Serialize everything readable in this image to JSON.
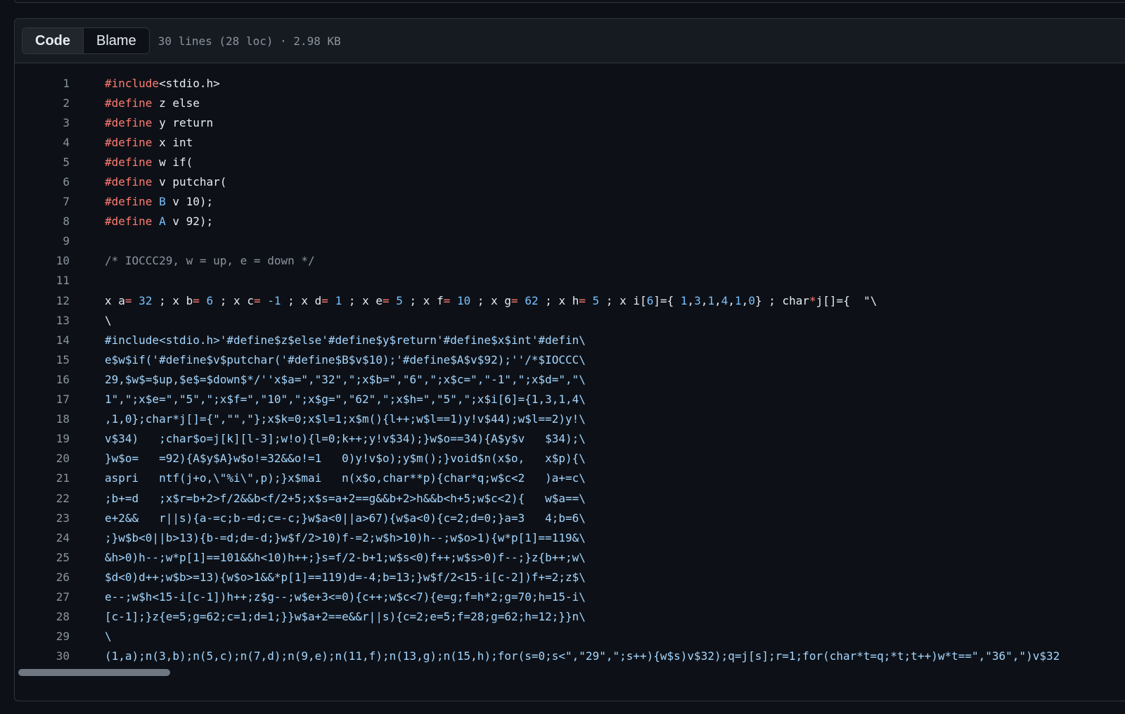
{
  "tabs": {
    "code": "Code",
    "blame": "Blame"
  },
  "file_info": "30 lines (28 loc) · 2.98 KB",
  "lines": [
    {
      "n": "1",
      "t": [
        [
          "kw",
          "#include"
        ],
        [
          "",
          "<stdio.h>"
        ]
      ]
    },
    {
      "n": "2",
      "t": [
        [
          "kw",
          "#define"
        ],
        [
          "",
          " z else"
        ]
      ]
    },
    {
      "n": "3",
      "t": [
        [
          "kw",
          "#define"
        ],
        [
          "",
          " y return"
        ]
      ]
    },
    {
      "n": "4",
      "t": [
        [
          "kw",
          "#define"
        ],
        [
          "",
          " x int"
        ]
      ]
    },
    {
      "n": "5",
      "t": [
        [
          "kw",
          "#define"
        ],
        [
          "",
          " w if("
        ]
      ]
    },
    {
      "n": "6",
      "t": [
        [
          "kw",
          "#define"
        ],
        [
          "",
          " v putchar("
        ]
      ]
    },
    {
      "n": "7",
      "t": [
        [
          "kw",
          "#define"
        ],
        [
          "",
          " "
        ],
        [
          "const",
          "B"
        ],
        [
          "",
          " v 10);"
        ]
      ]
    },
    {
      "n": "8",
      "t": [
        [
          "kw",
          "#define"
        ],
        [
          "",
          " "
        ],
        [
          "const",
          "A"
        ],
        [
          "",
          " v 92);"
        ]
      ]
    },
    {
      "n": "9",
      "t": [
        [
          "",
          ""
        ]
      ]
    },
    {
      "n": "10",
      "t": [
        [
          "comment",
          "/* IOCCC29, w = up, e = down */"
        ]
      ]
    },
    {
      "n": "11",
      "t": [
        [
          "",
          ""
        ]
      ]
    },
    {
      "n": "12",
      "t": [
        [
          "",
          "x a"
        ],
        [
          "kw",
          "="
        ],
        [
          "const",
          " 32"
        ],
        [
          "",
          " ; x b"
        ],
        [
          "kw",
          "="
        ],
        [
          "const",
          " 6"
        ],
        [
          "",
          " ; x c"
        ],
        [
          "kw",
          "="
        ],
        [
          "const",
          " -1"
        ],
        [
          "",
          " ; x d"
        ],
        [
          "kw",
          "="
        ],
        [
          "const",
          " 1"
        ],
        [
          "",
          " ; x e"
        ],
        [
          "kw",
          "="
        ],
        [
          "const",
          " 5"
        ],
        [
          "",
          " ; x f"
        ],
        [
          "kw",
          "="
        ],
        [
          "const",
          " 10"
        ],
        [
          "",
          " ; x g"
        ],
        [
          "kw",
          "="
        ],
        [
          "const",
          " 62"
        ],
        [
          "",
          " ; x h"
        ],
        [
          "kw",
          "="
        ],
        [
          "const",
          " 5"
        ],
        [
          "",
          " ; x i["
        ],
        [
          "const",
          "6"
        ],
        [
          "",
          "]={ "
        ],
        [
          "const",
          "1"
        ],
        [
          "",
          ","
        ],
        [
          "const",
          "3"
        ],
        [
          "",
          ","
        ],
        [
          "const",
          "1"
        ],
        [
          "",
          ","
        ],
        [
          "const",
          "4"
        ],
        [
          "",
          ","
        ],
        [
          "const",
          "1"
        ],
        [
          "",
          ","
        ],
        [
          "const",
          "0"
        ],
        [
          "",
          "} ; char"
        ],
        [
          "kw",
          "*"
        ],
        [
          "",
          "j[]={  \"\\"
        ]
      ]
    },
    {
      "n": "13",
      "t": [
        [
          "",
          "\\"
        ]
      ]
    },
    {
      "n": "14",
      "t": [
        [
          "str",
          "#include<stdio.h>'#define$z$else'#define$y$return'#define$x$int'#defin\\"
        ]
      ]
    },
    {
      "n": "15",
      "t": [
        [
          "str",
          "e$w$if('#define$v$putchar('#define$B$v$10);'#define$A$v$92);''/*$IOCCC\\"
        ]
      ]
    },
    {
      "n": "16",
      "t": [
        [
          "str",
          "29,$w$=$up,$e$=$down$*/''x$a=\",\"32\",\";x$b=\",\"6\",\";x$c=\",\"-1\",\";x$d=\",\"\\"
        ]
      ]
    },
    {
      "n": "17",
      "t": [
        [
          "str",
          "1\",\";x$e=\",\"5\",\";x$f=\",\"10\",\";x$g=\",\"62\",\";x$h=\",\"5\",\";x$i[6]={1,3,1,4\\"
        ]
      ]
    },
    {
      "n": "18",
      "t": [
        [
          "str",
          ",1,0};char*j[]={\",\"\",\"};x$k=0;x$l=1;x$m(){l++;w$l==1)y!v$44);w$l==2)y!\\"
        ]
      ]
    },
    {
      "n": "19",
      "t": [
        [
          "str",
          "v$34)   ;char$o=j[k][l-3];w!o){l=0;k++;y!v$34);}w$o==34){A$y$v   $34);\\"
        ]
      ]
    },
    {
      "n": "20",
      "t": [
        [
          "str",
          "}w$o=   =92){A$y$A}w$o!=32&&o!=1   0)y!v$o);y$m();}void$n(x$o,   x$p){\\"
        ]
      ]
    },
    {
      "n": "21",
      "t": [
        [
          "str",
          "aspri   ntf(j+o,\\\"%i\\\",p);}x$mai   n(x$o,char**p){char*q;w$c<2   )a+=c\\"
        ]
      ]
    },
    {
      "n": "22",
      "t": [
        [
          "str",
          ";b+=d   ;x$r=b+2>f/2&&b<f/2+5;x$s=a+2==g&&b+2>h&&b<h+5;w$c<2){   w$a==\\"
        ]
      ]
    },
    {
      "n": "23",
      "t": [
        [
          "str",
          "e+2&&   r||s){a-=c;b-=d;c=-c;}w$a<0||a>67){w$a<0){c=2;d=0;}a=3   4;b=6\\"
        ]
      ]
    },
    {
      "n": "24",
      "t": [
        [
          "str",
          ";}w$b<0||b>13){b-=d;d=-d;}w$f/2>10)f-=2;w$h>10)h--;w$o>1){w*p[1]==119&\\"
        ]
      ]
    },
    {
      "n": "25",
      "t": [
        [
          "str",
          "&h>0)h--;w*p[1]==101&&h<10)h++;}s=f/2-b+1;w$s<0)f++;w$s>0)f--;}z{b++;w\\"
        ]
      ]
    },
    {
      "n": "26",
      "t": [
        [
          "str",
          "$d<0)d++;w$b>=13){w$o>1&&*p[1]==119)d=-4;b=13;}w$f/2<15-i[c-2])f+=2;z$\\"
        ]
      ]
    },
    {
      "n": "27",
      "t": [
        [
          "str",
          "e--;w$h<15-i[c-1])h++;z$g--;w$e+3<=0){c++;w$c<7){e=g;f=h*2;g=70;h=15-i\\"
        ]
      ]
    },
    {
      "n": "28",
      "t": [
        [
          "str",
          "[c-1];}z{e=5;g=62;c=1;d=1;}}w$a+2==e&&r||s){c=2;e=5;f=28;g=62;h=12;}}n\\"
        ]
      ]
    },
    {
      "n": "29",
      "t": [
        [
          "str",
          "\\"
        ]
      ]
    },
    {
      "n": "30",
      "t": [
        [
          "str",
          "(1,a);n(3,b);n(5,c);n(7,d);n(9,e);n(11,f);n(13,g);n(15,h);for(s=0;s<\",\"29\",\";s++){w$s)v$32);q=j[s];r=1;for(char*t=q;*t;t++)w*t==\",\"36\",\")v$32"
        ]
      ]
    }
  ]
}
